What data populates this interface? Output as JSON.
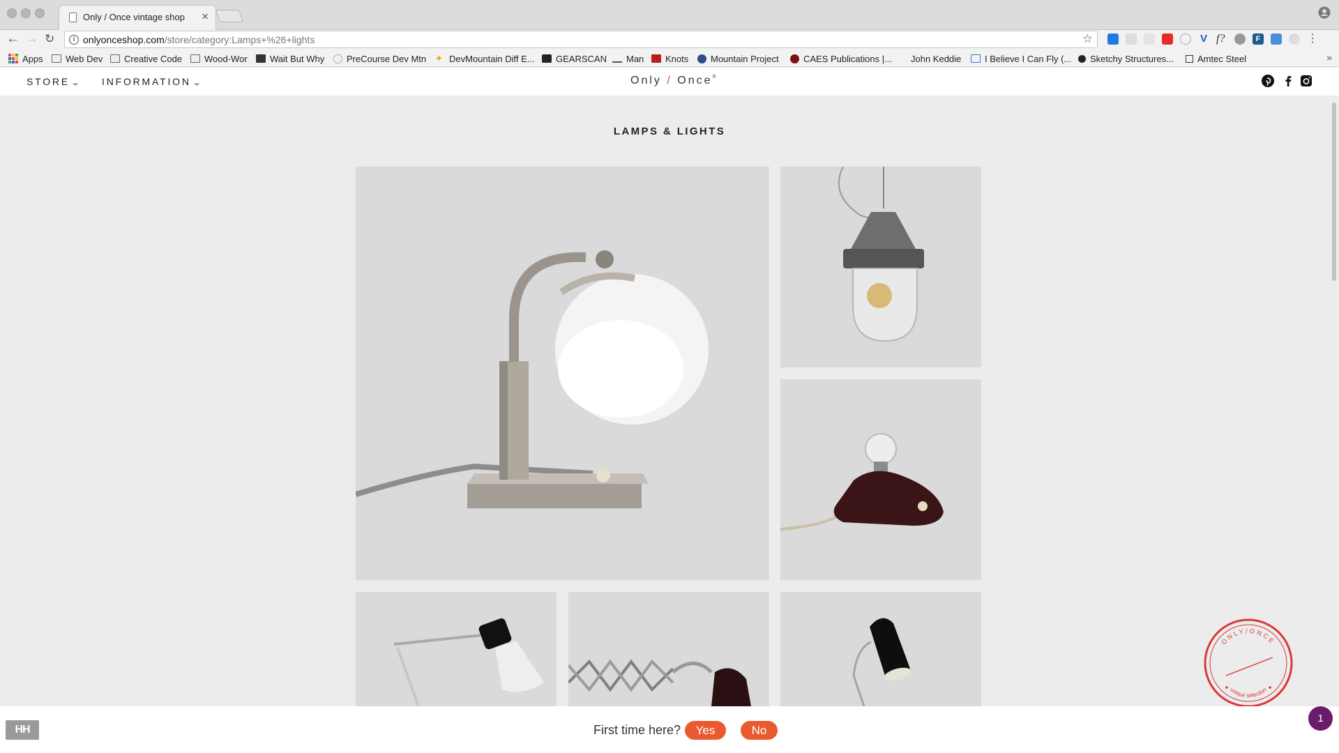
{
  "browser": {
    "tab_title": "Only / Once vintage shop",
    "tab_close": "×",
    "url_host": "onlyonceshop.com",
    "url_path": "/store/category:Lamps+%26+lights",
    "bookmarks": [
      {
        "label": "Apps",
        "icon": "apps-grid-icon"
      },
      {
        "label": "Web Dev",
        "icon": "folder-icon"
      },
      {
        "label": "Creative Code",
        "icon": "folder-icon"
      },
      {
        "label": "Wood-Wor",
        "icon": "folder-icon"
      },
      {
        "label": "Wait But Why",
        "icon": "wbw-icon"
      },
      {
        "label": "PreCourse Dev Mtn",
        "icon": "globe-icon"
      },
      {
        "label": "DevMountain Diff E...",
        "icon": "devmountain-icon"
      },
      {
        "label": "GEARSCAN",
        "icon": "gearscan-icon"
      },
      {
        "label": "Man",
        "icon": "man-icon"
      },
      {
        "label": "Knots",
        "icon": "knots-icon"
      },
      {
        "label": "Mountain Project",
        "icon": "mountain-project-icon"
      },
      {
        "label": "CAES Publications |...",
        "icon": "caes-icon"
      },
      {
        "label": "John Keddie",
        "icon": ""
      },
      {
        "label": "I Believe I Can Fly (...",
        "icon": "image-icon"
      },
      {
        "label": "Sketchy Structures...",
        "icon": "sketchy-icon"
      },
      {
        "label": "Amtec Steel",
        "icon": "amtec-icon"
      }
    ],
    "bookmarks_more": "»"
  },
  "site": {
    "nav": [
      {
        "label": "STORE",
        "chevron": "⌄"
      },
      {
        "label": "INFORMATION",
        "chevron": "⌄"
      }
    ],
    "logo": {
      "left": "Only",
      "slash": "/",
      "right": "Once",
      "mark": "®"
    },
    "social_icons": [
      "pinterest-icon",
      "facebook-icon",
      "instagram-icon"
    ],
    "page_title": "LAMPS & LIGHTS",
    "products": [
      {
        "name": "chrome-desk-lamp-glass-globe"
      },
      {
        "name": "industrial-pendant-cage-lamp"
      },
      {
        "name": "bakelite-bedside-lamp"
      },
      {
        "name": "white-architect-desk-lamp"
      },
      {
        "name": "scissor-wall-lamp"
      },
      {
        "name": "black-gooseneck-lamp"
      }
    ]
  },
  "footer": {
    "prompt": "First time here?",
    "yes": "Yes",
    "no": "No",
    "hh_logo": "HH",
    "notification_count": "1"
  },
  "stamp": {
    "top_text": "ONLY/ONCE",
    "bottom_text": "unique selection"
  },
  "colors": {
    "accent": "#ea5a30",
    "stamp_red": "#d9373a",
    "logo_slash": "#d64a3a",
    "badge": "#6a1b6a",
    "page_bg": "#ececec"
  }
}
